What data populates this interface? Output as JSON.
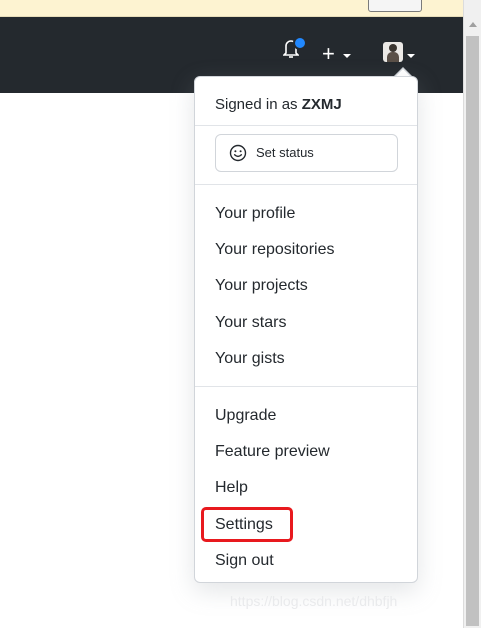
{
  "header": {
    "icons": {
      "notifications": "bell-icon",
      "create": "plus-icon",
      "avatar": "avatar"
    },
    "plus_glyph": "+",
    "colors": {
      "header_bg": "#24292e",
      "notification_dot": "#2188ff",
      "highlight_border": "#e8191e"
    }
  },
  "dropdown": {
    "signed_in_prefix": "Signed in as ",
    "username": "ZXMJ",
    "status_button": "Set status",
    "profile_section": [
      "Your profile",
      "Your repositories",
      "Your projects",
      "Your stars",
      "Your gists"
    ],
    "account_section": [
      "Upgrade",
      "Feature preview",
      "Help",
      "Settings",
      "Sign out"
    ]
  },
  "watermark": "https://blog.csdn.net/dhbfjh"
}
